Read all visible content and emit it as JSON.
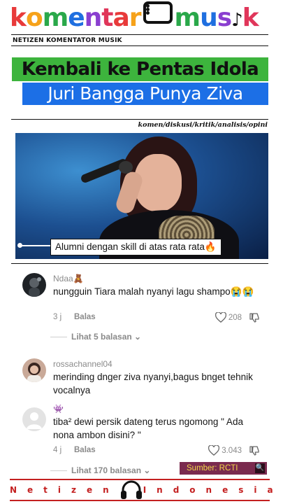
{
  "brand": {
    "logo_part1": "komentar",
    "logo_part2": "mus",
    "logo_part3": "k",
    "tagline": "NETIZEN KOMENTATOR MUSIK",
    "colors": [
      "#e83a3a",
      "#f6a21a",
      "#2aa84a",
      "#1f6fe0",
      "#8a3fd0",
      "#e0365a"
    ]
  },
  "headline": {
    "line1": "Kembali ke Pentas Idola",
    "line2": "Juri Bangga Punya Ziva",
    "line1_bg": "#3db43d",
    "line2_bg": "#1c6fe6"
  },
  "categories": "komen/diskusi/kritik/analisis/opini",
  "video": {
    "caption": "Alumni dengan skill di atas rata rata🔥"
  },
  "comments": [
    {
      "username": "Ndaa🧸",
      "text": "nungguin Tiara malah nyanyi lagu shampo😭😭",
      "time": "3 j",
      "reply_label": "Balas",
      "likes": "208",
      "view_replies": "Lihat 5 balasan",
      "avatar": "photo-dark"
    },
    {
      "username": "rossachannel04",
      "text": "merinding dnger ziva nyanyi,bagus bnget tehnik vocalnya",
      "avatar": "photo-woman"
    },
    {
      "username": "👾",
      "text": "tiba² dewi persik dateng terus ngomong \" Ada nona ambon disini? \"",
      "time": "4 j",
      "reply_label": "Balas",
      "likes": "3.043",
      "view_replies": "Lihat 170 balasan",
      "avatar": "default-person"
    }
  ],
  "source": {
    "label": "Sumber: RCTI",
    "search_icon": "🔍"
  },
  "footer": {
    "left_word": "Netizen",
    "right_word": "Indonesia",
    "icon": "headphones-icon",
    "accent_color": "#c42020"
  }
}
